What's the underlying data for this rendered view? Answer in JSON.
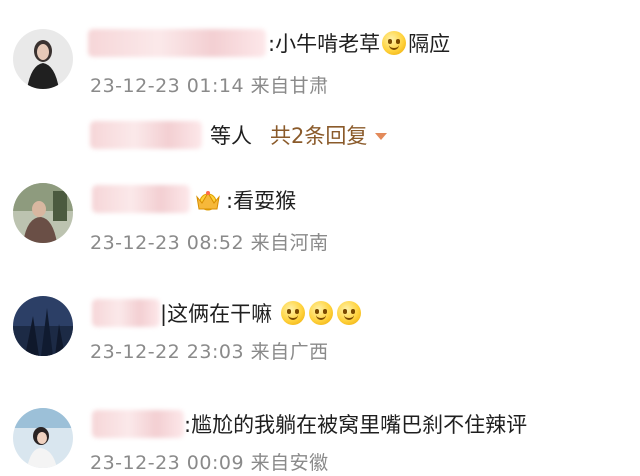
{
  "comments": [
    {
      "text": ":小牛啃老草",
      "suffix": "隔应",
      "time": "23-12-23 01:14",
      "location": "来自甘肃"
    },
    {
      "text": ":看耍猴",
      "time": "23-12-23 08:52",
      "location": "来自河南"
    },
    {
      "text": "这俩在干嘛",
      "time": "23-12-22 23:03",
      "location": "来自广西"
    },
    {
      "text": ":尴尬的我躺在被窝里嘴巴刹不住辣评",
      "time": "23-12-23 00:09",
      "location": "来自安徽"
    }
  ],
  "reply_summary": {
    "users_suffix": "等人",
    "count_label": "共2条回复"
  },
  "icons": {
    "emoji_laugh": "laugh-emoji-icon",
    "emoji_grin": "grin-emoji-icon",
    "crown": "crown-badge-icon",
    "expand": "caret-down-icon"
  },
  "colors": {
    "meta_text": "#8a8a8a",
    "reply_link": "#8a5a2a",
    "caret": "#e38a5a"
  }
}
